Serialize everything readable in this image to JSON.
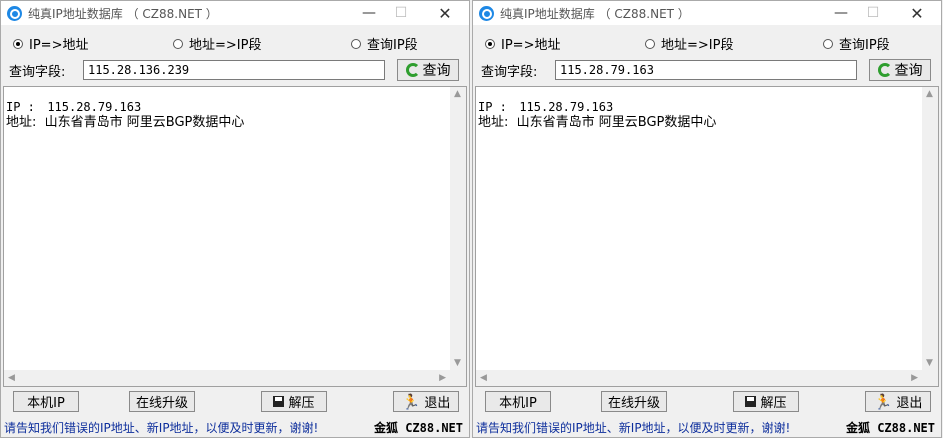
{
  "windows": [
    {
      "title": "纯真IP地址数据库 （ CZ88.NET ）",
      "radios": [
        {
          "label": "IP=>地址",
          "checked": true
        },
        {
          "label": "地址=>IP段",
          "checked": false
        },
        {
          "label": "查询IP段",
          "checked": false
        }
      ],
      "query_label": "查询字段:",
      "query_value": "115.28.136.239",
      "query_button": "查询",
      "result_ip_label": "IP :",
      "result_ip_value": "115.28.79.163",
      "result_addr_label": "地址:",
      "result_addr_value": "山东省青岛市 阿里云BGP数据中心",
      "buttons": {
        "local_ip": "本机IP",
        "upgrade": "在线升级",
        "extract": "解压",
        "exit": "退出"
      },
      "status_msg": "请告知我们错误的IP地址、新IP地址，以便及时更新，谢谢!",
      "status_brand": "金狐 CZ88.NET"
    },
    {
      "title": "纯真IP地址数据库 （ CZ88.NET ）",
      "radios": [
        {
          "label": "IP=>地址",
          "checked": true
        },
        {
          "label": "地址=>IP段",
          "checked": false
        },
        {
          "label": "查询IP段",
          "checked": false
        }
      ],
      "query_label": "查询字段:",
      "query_value": "115.28.79.163",
      "query_button": "查询",
      "result_ip_label": "IP :",
      "result_ip_value": "115.28.79.163",
      "result_addr_label": "地址:",
      "result_addr_value": "山东省青岛市 阿里云BGP数据中心",
      "buttons": {
        "local_ip": "本机IP",
        "upgrade": "在线升级",
        "extract": "解压",
        "exit": "退出"
      },
      "status_msg": "请告知我们错误的IP地址、新IP地址，以便及时更新，谢谢!",
      "status_brand": "金狐 CZ88.NET"
    }
  ],
  "icons": {
    "app": "magnifier-globe-icon",
    "minimize": "minimize-icon",
    "maximize": "maximize-icon",
    "close": "close-icon",
    "refresh": "refresh-icon",
    "save": "save-icon",
    "exit": "running-man-icon"
  }
}
